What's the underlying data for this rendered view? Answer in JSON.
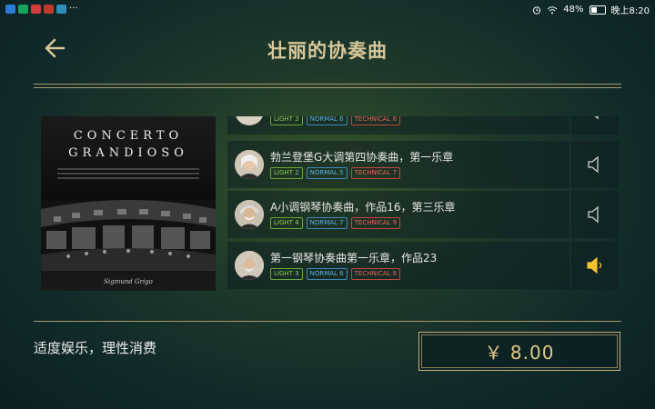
{
  "status_bar": {
    "battery": "48%",
    "time": "晚上8:20",
    "battery_level": 0.48,
    "app_icons": [
      "social-app-icon",
      "camera-app-icon",
      "email-app-icon",
      "reader-app-icon",
      "tv-app-icon"
    ],
    "more": "···"
  },
  "header": {
    "title": "壮丽的协奏曲"
  },
  "cover": {
    "title_line1": "CONCERTO",
    "title_line2": "GRANDIOSO",
    "credit": "Sigmund Grigo"
  },
  "pieces": [
    {
      "title": "",
      "light": "LIGHT 3",
      "normal": "NORMAL 6",
      "technical": "TECHNICAL 8",
      "speaker": "speaker-icon",
      "active": false
    },
    {
      "title": "勃兰登堡G大调第四协奏曲，第一乐章",
      "light": "LIGHT 2",
      "normal": "NORMAL 5",
      "technical": "TECHNICAL 7",
      "speaker": "speaker-icon",
      "active": false
    },
    {
      "title": "A小调钢琴协奏曲，作品16，第三乐章",
      "light": "LIGHT 4",
      "normal": "NORMAL 7",
      "technical": "TECHNICAL 9",
      "speaker": "speaker-icon",
      "active": false
    },
    {
      "title": "第一钢琴协奏曲第一乐章，作品23",
      "light": "LIGHT 3",
      "normal": "NORMAL 6",
      "technical": "TECHNICAL 8",
      "speaker": "speaker-playing-icon",
      "active": true
    }
  ],
  "footer": {
    "slogan": "适度娱乐，理性消费",
    "price": "￥ 8.00"
  },
  "colors": {
    "gold": "#d9c89a",
    "light_badge": "#8fd14f",
    "normal_badge": "#58b0e8",
    "technical_badge": "#e8645a",
    "active_speaker": "#f2c230"
  }
}
